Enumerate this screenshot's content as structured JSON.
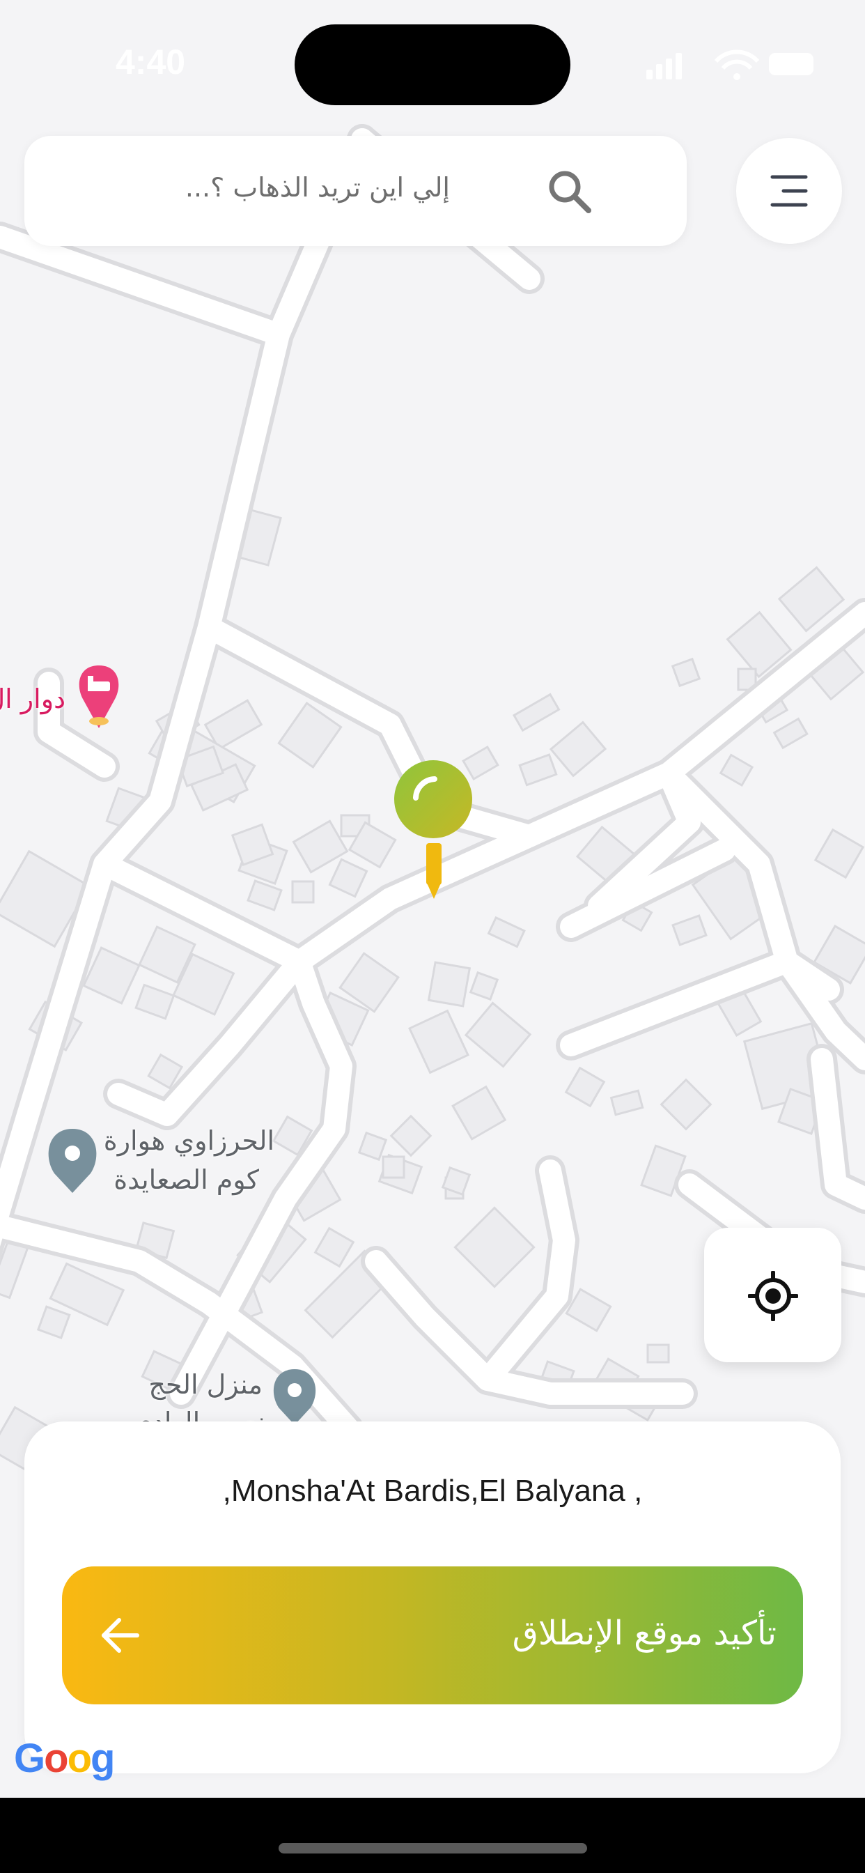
{
  "status_bar": {
    "time": "4:40"
  },
  "search": {
    "placeholder": "إلي اين تريد الذهاب ؟..."
  },
  "map": {
    "pois": [
      {
        "label": "دوار ال"
      },
      {
        "label_line1": "الحرزاوي هوارة",
        "label_line2": "كوم الصعايدة"
      },
      {
        "label_line1": "منزل الحج",
        "label_line2": "منصور الهادي"
      }
    ],
    "watermark": "Google"
  },
  "pickup": {
    "address": ",Monsha'At Bardis,El Balyana ,",
    "confirm_label": "تأكيد موقع الإنطلاق"
  },
  "colors": {
    "gradient_start": "#fab812",
    "gradient_end": "#6eb945",
    "pin_green": "#7bbf43",
    "pin_yellow": "#f0b90f",
    "poi_red": "#e91e63",
    "poi_gray": "#78909c"
  },
  "icons": [
    "search-icon",
    "menu-icon",
    "my-location-icon",
    "arrow-left-icon",
    "location-pin-icon",
    "hotel-pin-icon",
    "poi-marker-icon"
  ]
}
